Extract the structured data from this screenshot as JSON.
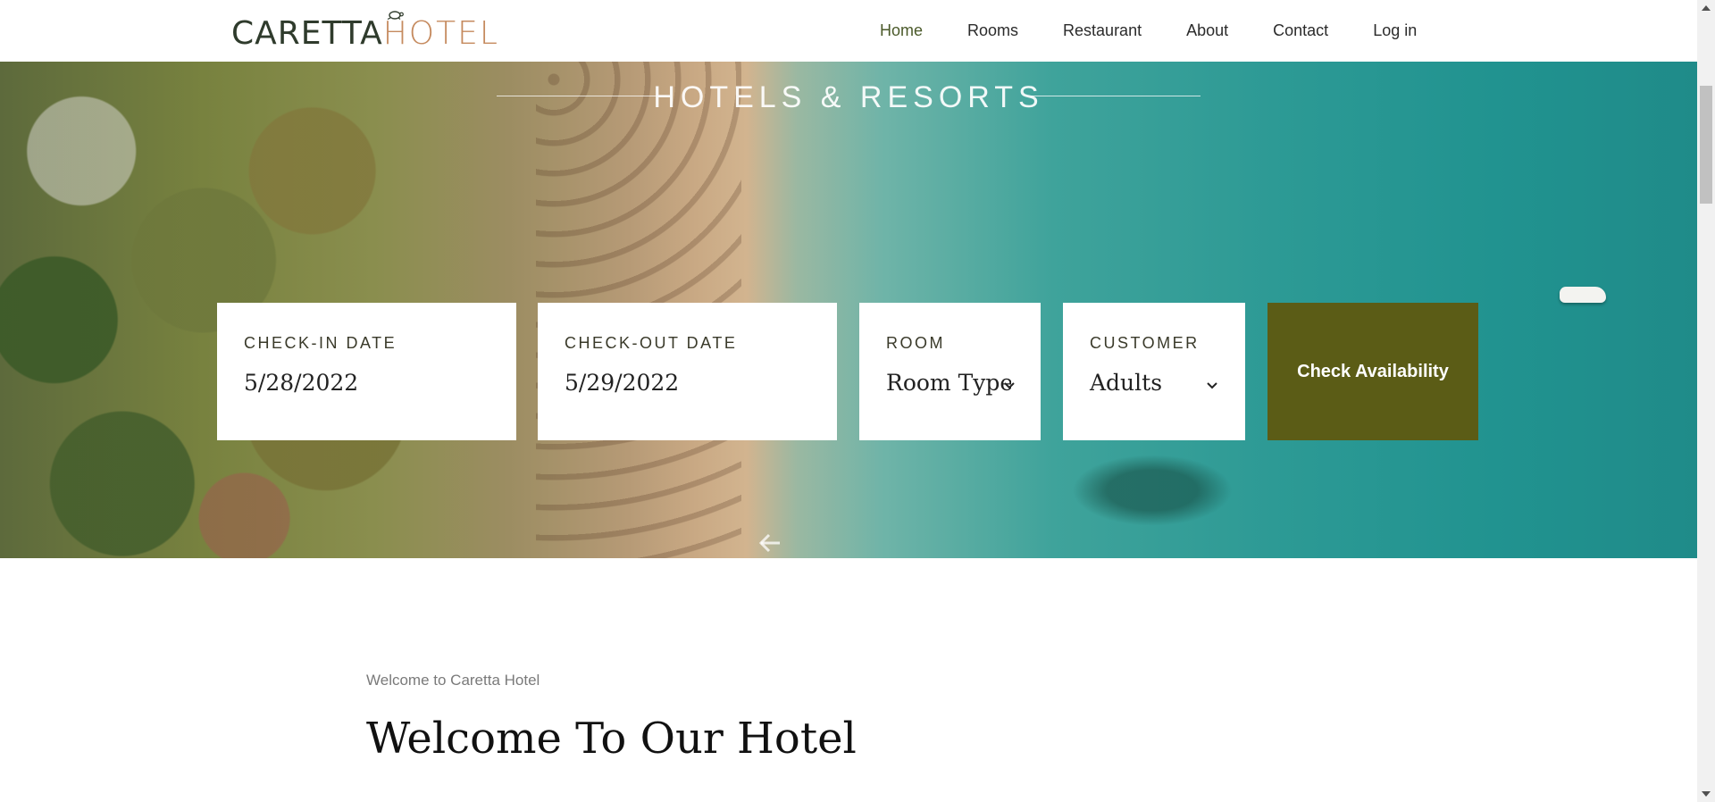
{
  "header": {
    "logo_part1": "CARETTA",
    "logo_part2": "HOTEL",
    "nav": [
      {
        "label": "Home",
        "active": true
      },
      {
        "label": "Rooms"
      },
      {
        "label": "Restaurant"
      },
      {
        "label": "About"
      },
      {
        "label": "Contact"
      },
      {
        "label": "Log in"
      }
    ]
  },
  "hero": {
    "title": "HOTELS & RESORTS"
  },
  "booking": {
    "checkin_label": "CHECK-IN DATE",
    "checkin_value": "5/28/2022",
    "checkout_label": "CHECK-OUT DATE",
    "checkout_value": "5/29/2022",
    "room_label": "ROOM",
    "room_value": "Room Type",
    "customer_label": "CUSTOMER",
    "customer_value": "Adults",
    "button_label": "Check Availability"
  },
  "welcome": {
    "subtitle": "Welcome to Caretta Hotel",
    "title": "Welcome To Our Hotel"
  },
  "colors": {
    "accent": "#5b5c16",
    "logo_dark": "#2f3b2c",
    "logo_light": "#c58a5e"
  }
}
